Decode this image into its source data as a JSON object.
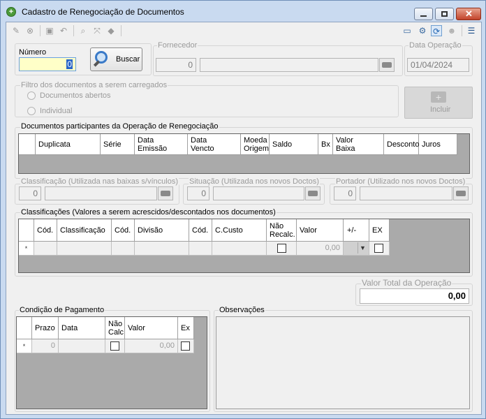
{
  "window": {
    "title": "Cadastro de Renegociação de Documentos"
  },
  "toolbar": {
    "left_icons": [
      "edit-icon",
      "cancel-icon",
      "save-icon",
      "undo-icon",
      "zoom-icon",
      "expand-icon",
      "eraser-icon"
    ],
    "right_icons": [
      "screen-icon",
      "settings-icon",
      "refresh-icon",
      "user-icon",
      "panel-icon"
    ]
  },
  "numero": {
    "label": "Número",
    "value": "0"
  },
  "buscar": {
    "label": "Buscar"
  },
  "fornecedor": {
    "label": "Fornecedor",
    "code": "0",
    "name": ""
  },
  "data_operacao": {
    "label": "Data Operação",
    "value": "01/04/2024"
  },
  "filtro": {
    "label": "Filtro dos documentos a serem carregados",
    "options": [
      "Documentos abertos",
      "Individual"
    ]
  },
  "incluir": {
    "label": "Incluir"
  },
  "docs": {
    "title": "Documentos participantes da Operação de Renegociação",
    "columns": [
      "Duplicata",
      "Série",
      "Data\nEmissão",
      "Data\nVencto",
      "Moeda\nOrigem",
      "Saldo",
      "Bx",
      "Valor\nBaixa",
      "Desconto",
      "Juros"
    ]
  },
  "classificacao": {
    "label": "Classificação (Utilizada nas baixas s/vínculos)",
    "code": "0"
  },
  "situacao": {
    "label": "Situação (Utilizada nos novos Doctos)",
    "code": "0"
  },
  "portador": {
    "label": "Portador (Utilizado nos novos Doctos)",
    "code": "0"
  },
  "classif_grid": {
    "title": "Classificações (Valores a serem acrescidos/descontados nos documentos)",
    "columns": [
      "Cód.",
      "Classificação",
      "Cód.",
      "Divisão",
      "Cód.",
      "C.Custo",
      "Não\nRecalc.",
      "Valor",
      "+/-",
      "EX"
    ],
    "row_marker": "*",
    "row_valor": "0,00"
  },
  "valor_total": {
    "label": "Valor Total da Operação",
    "value": "0,00"
  },
  "condicao": {
    "title": "Condição de Pagamento",
    "columns": [
      "Prazo",
      "Data",
      "Não\nCalc",
      "Valor",
      "Ex"
    ],
    "row_marker": "*",
    "row_prazo": "0",
    "row_valor": "0,00"
  },
  "observacoes": {
    "label": "Observações"
  }
}
